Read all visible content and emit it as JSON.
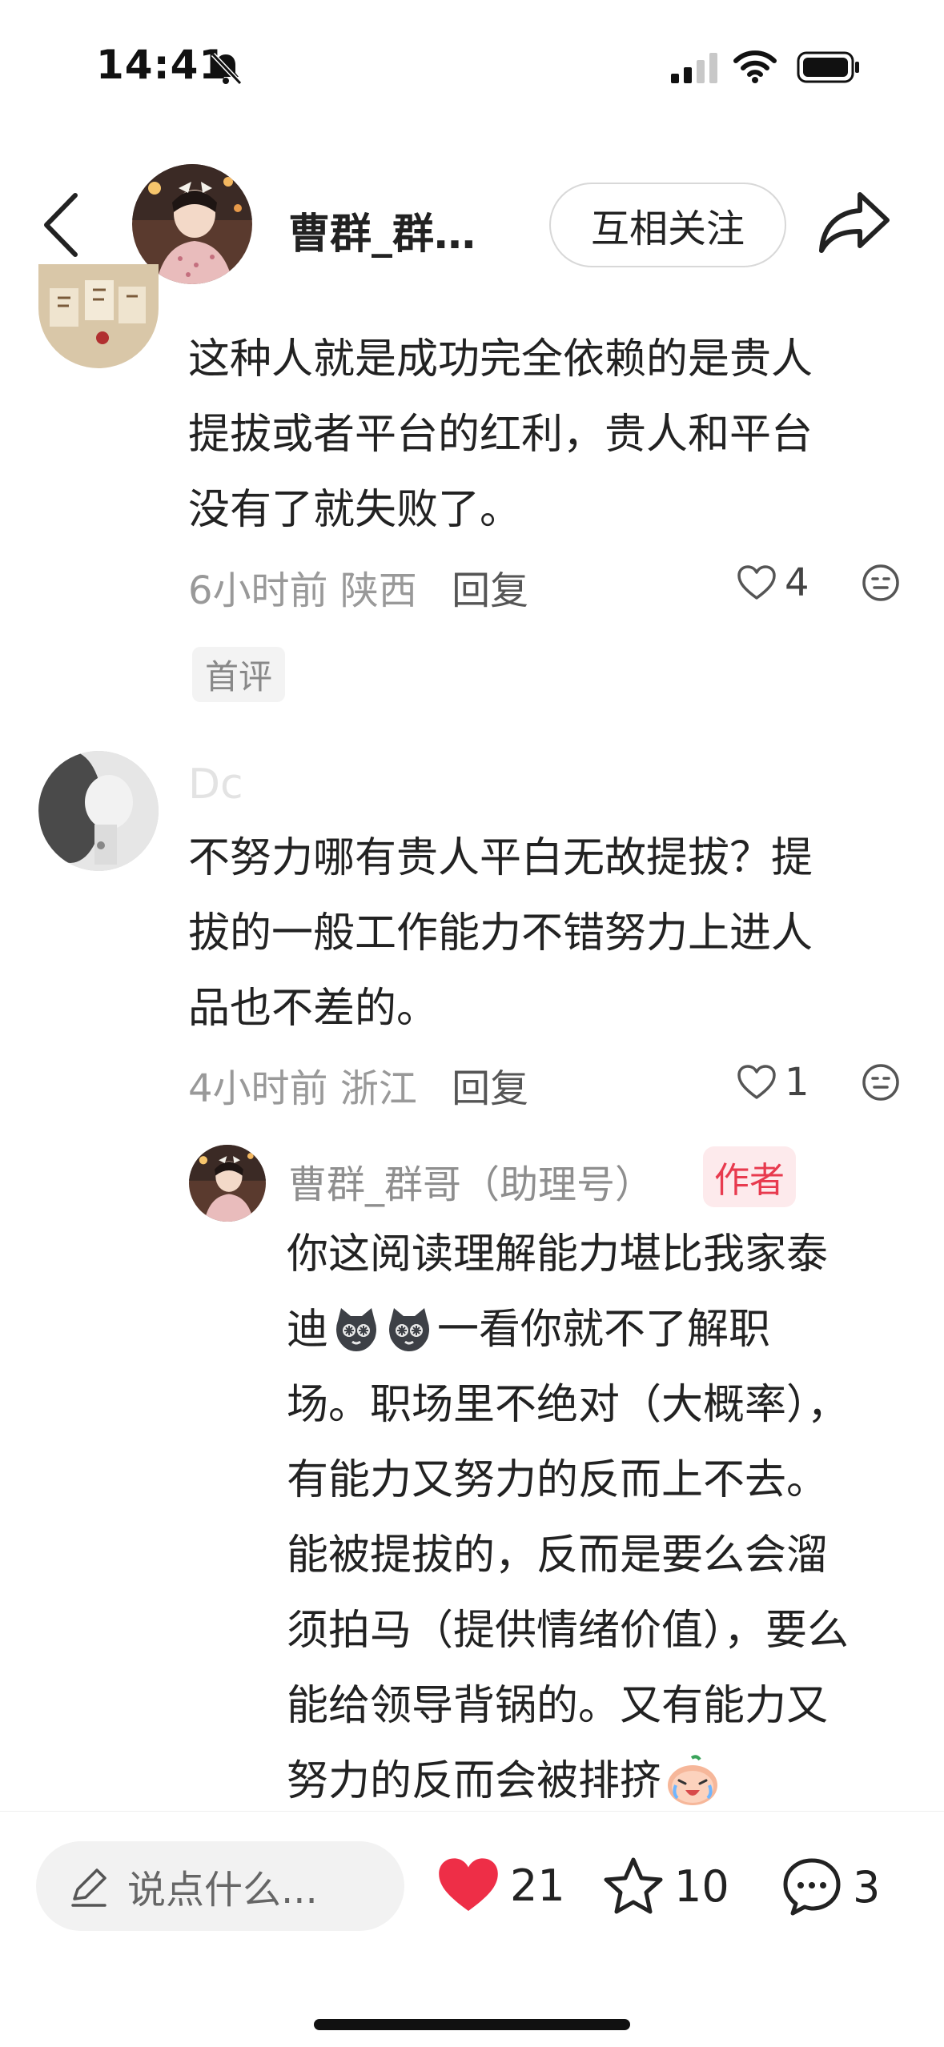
{
  "status_bar": {
    "time": "14:41"
  },
  "header": {
    "username": "曹群_群…",
    "follow_label": "互相关注"
  },
  "comments": [
    {
      "text_lines": [
        "这种人就是成功完全依赖的是贵人",
        "提拔或者平台的红利，贵人和平台",
        "没有了就失败了。"
      ],
      "time": "6小时前",
      "location": "陕西",
      "reply_label": "回复",
      "likes": "4",
      "tag": "首评"
    },
    {
      "author_partial": "Dc",
      "text_lines": [
        "不努力哪有贵人平白无故提拔？提",
        "拔的一般工作能力不错努力上进人",
        "品也不差的。"
      ],
      "time": "4小时前",
      "location": "浙江",
      "reply_label": "回复",
      "likes": "1"
    }
  ],
  "reply": {
    "author": "曹群_群哥（助理号）",
    "badge": "作者",
    "text_lines": [
      "你这阅读理解能力堪比我家泰",
      "迪",
      "一看你就不了解职",
      "场。职场里不绝对（大概率），",
      "有能力又努力的反而上不去。",
      "能被提拔的，反而是要么会溜",
      "须拍马（提供情绪价值），要么",
      "能给领导背锅的。又有能力又",
      "努力的反而会被排挤"
    ]
  },
  "bottom_bar": {
    "input_placeholder": "说点什么...",
    "likes": "21",
    "favorites": "10",
    "comments": "3"
  },
  "colors": {
    "accent_red": "#ee2e47",
    "badge_bg": "#fdeaec",
    "meta_gray": "#999999"
  }
}
